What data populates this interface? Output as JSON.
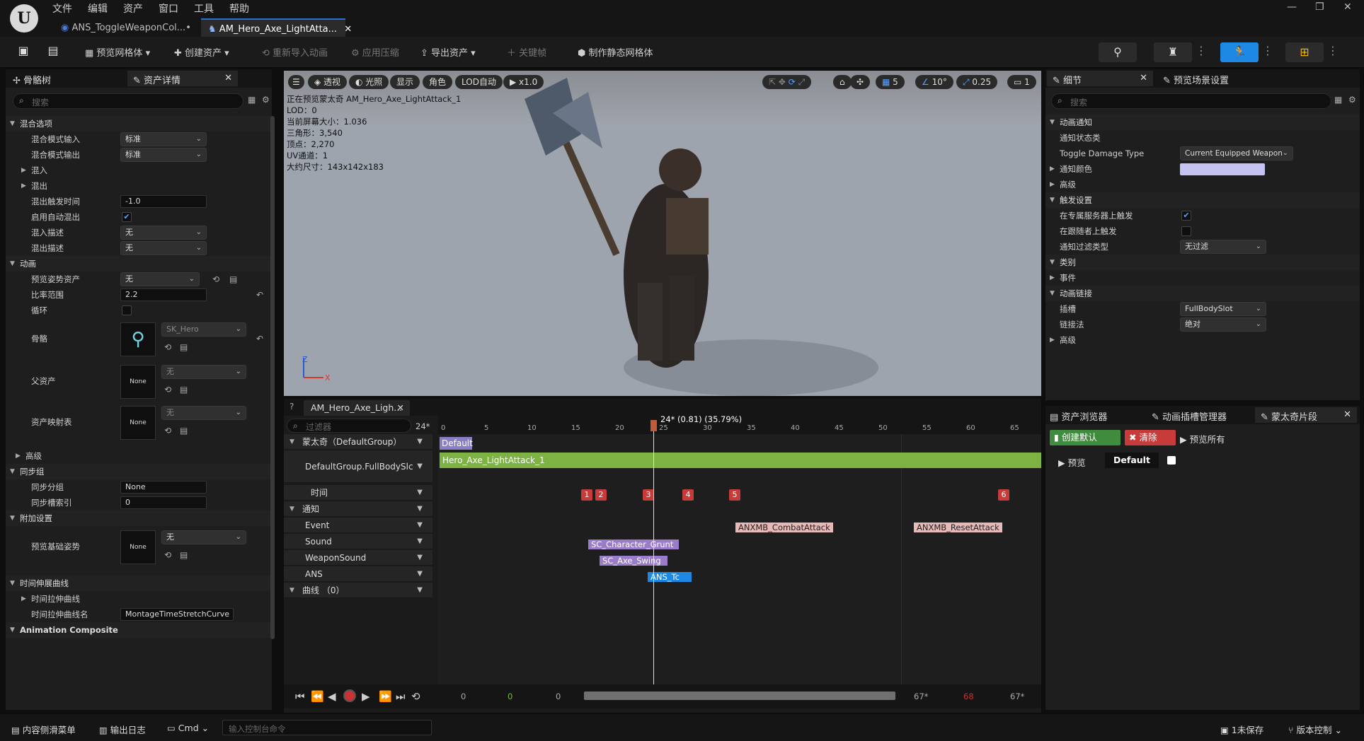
{
  "menu": [
    "文件",
    "编辑",
    "资产",
    "窗口",
    "工具",
    "帮助"
  ],
  "tabs": [
    {
      "label": "ANS_ToggleWeaponCol...•"
    },
    {
      "label": "AM_Hero_Axe_LightAtta..."
    }
  ],
  "toolbar": {
    "preview_mesh": "预览网格体",
    "create_asset": "创建资产",
    "reimport": "重新导入动画",
    "apply_compression": "应用压缩",
    "export_asset": "导出资产",
    "keyframe": "关键帧",
    "make_static_mesh": "制作静态网格体"
  },
  "left_panel": {
    "tab1": "骨骼树",
    "tab2": "资产详情",
    "search_placeholder": "搜索",
    "cat_blend": "混合选项",
    "blend_in_mode_label": "混合模式输入",
    "blend_in_mode_value": "标准",
    "blend_out_mode_label": "混合模式输出",
    "blend_out_mode_value": "标准",
    "blend_in": "混入",
    "blend_out": "混出",
    "blend_out_trigger_label": "混出触发时间",
    "blend_out_trigger_value": "-1.0",
    "auto_blend_out_label": "启用自动混出",
    "blend_in_desc_label": "混入描述",
    "blend_in_desc_value": "无",
    "blend_out_desc_label": "混出描述",
    "blend_out_desc_value": "无",
    "cat_anim": "动画",
    "preview_pose_label": "预览姿势资产",
    "preview_pose_value": "无",
    "rate_label": "比率范围",
    "rate_value": "2.2",
    "loop_label": "循环",
    "skeleton_label": "骨骼",
    "skeleton_value": "SK_Hero",
    "parent_label": "父资产",
    "parent_value": "无",
    "none": "None",
    "asset_map_label": "资产映射表",
    "asset_map_value": "无",
    "advanced": "高级",
    "cat_sync": "同步组",
    "sync_group_label": "同步分组",
    "sync_group_value": "None",
    "sync_slot_label": "同步槽索引",
    "sync_slot_value": "0",
    "cat_additive": "附加设置",
    "base_pose_label": "预览基础姿势",
    "base_pose_value": "无",
    "cat_time_curve": "时间伸展曲线",
    "time_curve": "时间拉伸曲线",
    "time_curve_name_label": "时间拉伸曲线名",
    "time_curve_name_value": "MontageTimeStretchCurve",
    "cat_composite": "Animation Composite"
  },
  "viewport": {
    "btn_perspective": "透视",
    "btn_lit": "光照",
    "btn_show": "显示",
    "btn_character": "角色",
    "btn_lod": "LOD自动",
    "btn_speed": "x1.0",
    "grid_value": "5",
    "angle_value": "10°",
    "scale_value": "0.25",
    "camera_value": "1",
    "info": [
      "正在预览蒙太奇 AM_Hero_Axe_LightAttack_1",
      "LOD：0",
      "当前屏幕大小：1.036",
      "三角形：3,540",
      "顶点：2,270",
      "UV通道：1",
      "大约尺寸：143x142x183"
    ],
    "axis_z": "Z",
    "axis_x": "X"
  },
  "timeline": {
    "tab": "AM_Hero_Axe_Ligh...",
    "filter_placeholder": "过滤器",
    "fps": "24*",
    "playhead_label": "24* (0.81) (35.79%)",
    "ticks": [
      "0",
      "5",
      "10",
      "15",
      "20",
      "25",
      "30",
      "35",
      "40",
      "45",
      "50",
      "55",
      "60",
      "65"
    ],
    "tracks": {
      "montage": "蒙太奇（DefaultGroup）",
      "slot": "DefaultGroup.FullBodySlc",
      "time": "时间",
      "notify": "通知",
      "event": "Event",
      "sound": "Sound",
      "weapon_sound": "WeaponSound",
      "ans": "ANS",
      "curve": "曲线 （0）"
    },
    "section": "Default",
    "anim_segment": "Hero_Axe_LightAttack_1",
    "markers": [
      "1",
      "2",
      "3",
      "4",
      "5",
      "6"
    ],
    "notifies": {
      "combat": "ANXMB_CombatAttack",
      "reset": "ANXMB_ResetAttack",
      "grunt": "SC_Character_Grunt",
      "swing": "SC_Axe_Swing",
      "ans": "ANS_Tc"
    },
    "transport": {
      "start": "0",
      "green": "0",
      "mid": "0",
      "end1": "67*",
      "red": "68",
      "end2": "67*"
    }
  },
  "details": {
    "tab1": "细节",
    "tab2": "预览场景设置",
    "search_placeholder": "搜索",
    "cat_notify": "动画通知",
    "notify_state_class": "通知状态类",
    "damage_type_label": "Toggle Damage Type",
    "damage_type_value": "Current Equipped Weapon",
    "notify_color": "通知颜色",
    "advanced": "高级",
    "cat_trigger": "触发设置",
    "dedicated_server": "在专属服务器上触发",
    "follower": "在跟随者上触发",
    "filter_type_label": "通知过滤类型",
    "filter_type_value": "无过滤",
    "cat_category": "类别",
    "event": "事件",
    "cat_link": "动画链接",
    "slot_label": "插槽",
    "slot_value": "FullBodySlot",
    "link_method_label": "链接法",
    "link_method_value": "绝对",
    "advanced2": "高级"
  },
  "montage_panel": {
    "tab1": "资产浏览器",
    "tab2": "动画插槽管理器",
    "tab3": "蒙太奇片段",
    "create_default": "创建默认",
    "clear": "清除",
    "preview_all": "预览所有",
    "preview": "预览",
    "section": "Default"
  },
  "statusbar": {
    "content_drawer": "内容侧滑菜单",
    "output_log": "输出日志",
    "cmd": "Cmd",
    "console_placeholder": "输入控制台命令",
    "unsaved": "1未保存",
    "source_control": "版本控制"
  },
  "colors": {
    "accent": "#1e88e5",
    "timeline_green": "#7cb342",
    "marker_red": "#c73b3b",
    "notify_purple": "#9b7cc9",
    "ans_blue": "#1e88e5",
    "notify_pink": "#e8b9b9"
  }
}
